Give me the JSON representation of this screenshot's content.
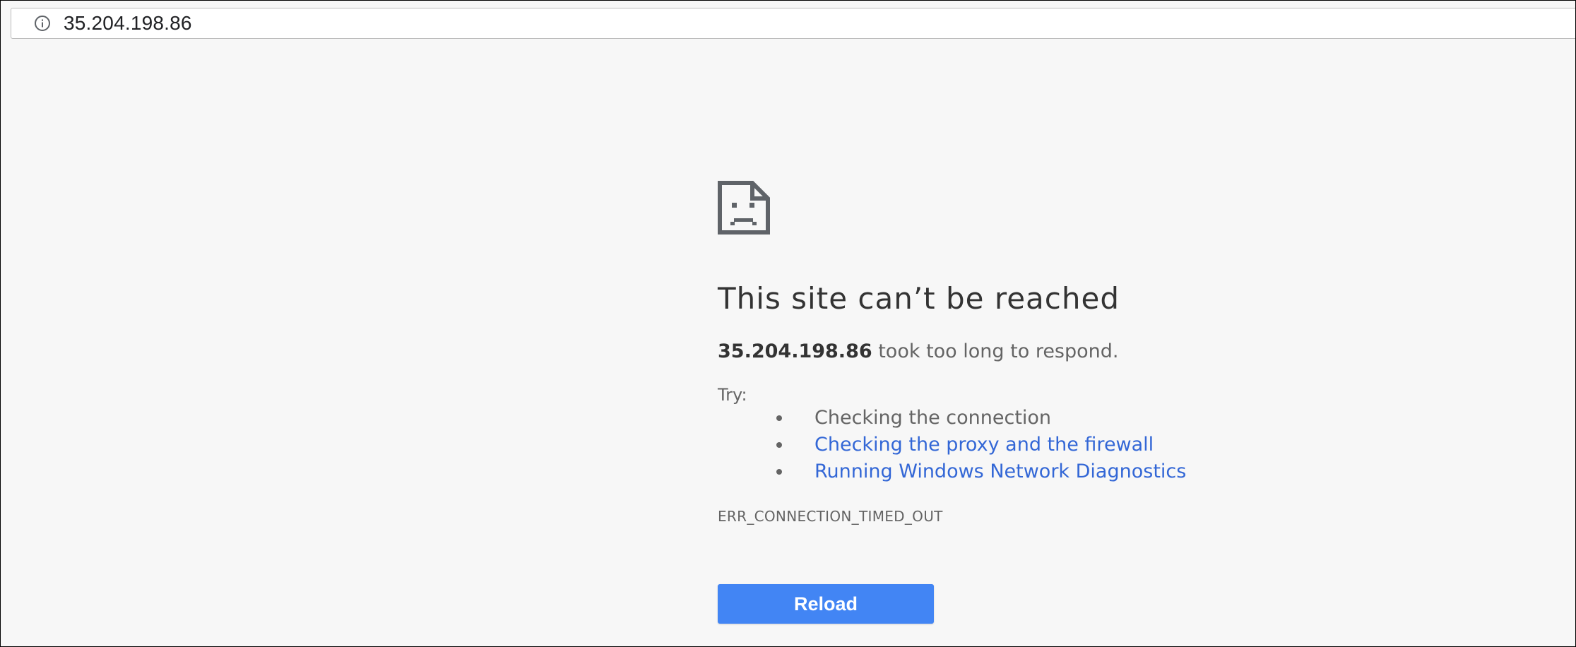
{
  "addressbar": {
    "icon": "info-icon",
    "url": "35.204.198.86"
  },
  "error": {
    "icon": "sad-page-icon",
    "title": "This site can’t be reached",
    "host": "35.204.198.86",
    "message": " took too long to respond.",
    "try_label": "Try:",
    "suggestions": [
      {
        "label": "Checking the connection",
        "link": false
      },
      {
        "label": "Checking the proxy and the firewall",
        "link": true
      },
      {
        "label": "Running Windows Network Diagnostics",
        "link": true
      }
    ],
    "code": "ERR_CONNECTION_TIMED_OUT",
    "reload_label": "Reload"
  },
  "colors": {
    "page_background": "#f7f7f7",
    "text": "#646464",
    "title": "#333333",
    "link": "#3367d6",
    "button": "#4285f4"
  }
}
